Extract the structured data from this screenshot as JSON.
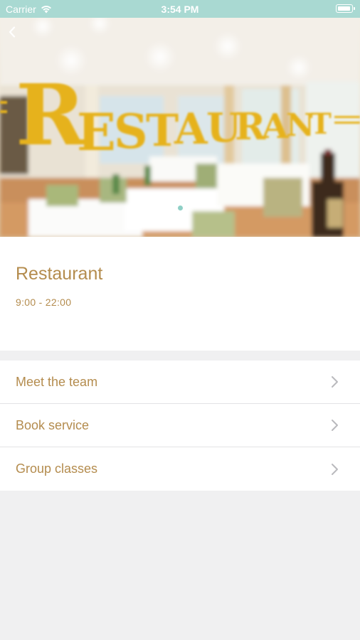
{
  "status_bar": {
    "carrier": "Carrier",
    "time": "3:54 PM"
  },
  "hero": {
    "sign_text": "RESTAURANT",
    "slide_count": 1,
    "active_slide": 1
  },
  "venue": {
    "name": "Restaurant",
    "hours": "9:00 - 22:00"
  },
  "menu": {
    "items": [
      {
        "label": "Meet the team"
      },
      {
        "label": "Book service"
      },
      {
        "label": "Group classes"
      }
    ]
  },
  "colors": {
    "accent": "#b48c4e",
    "status_bar": "#a9d9d2",
    "background": "#f0f0f1"
  },
  "icons": {
    "back": "chevron-left-icon",
    "disclosure": "chevron-right-icon",
    "wifi": "wifi-icon",
    "battery": "battery-icon"
  }
}
